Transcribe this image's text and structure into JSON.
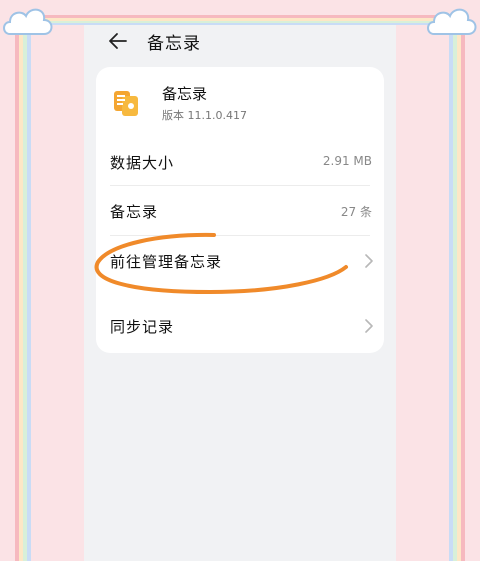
{
  "header": {
    "title": "备忘录"
  },
  "app": {
    "name": "备忘录",
    "version": "版本 11.1.0.417",
    "icon": "notes-app-icon"
  },
  "rows": [
    {
      "label": "数据大小",
      "value": "2.91 MB"
    },
    {
      "label": "备忘录",
      "value": "27 条"
    },
    {
      "label": "前往管理备忘录",
      "icon": "chevron-right-icon"
    }
  ],
  "sync": {
    "label": "同步记录",
    "icon": "chevron-right-icon"
  },
  "colors": {
    "screen_bg": "#f1f2f4",
    "card_bg": "#ffffff",
    "annotation": "#f08a2a",
    "app_icon": "#f4a632"
  }
}
